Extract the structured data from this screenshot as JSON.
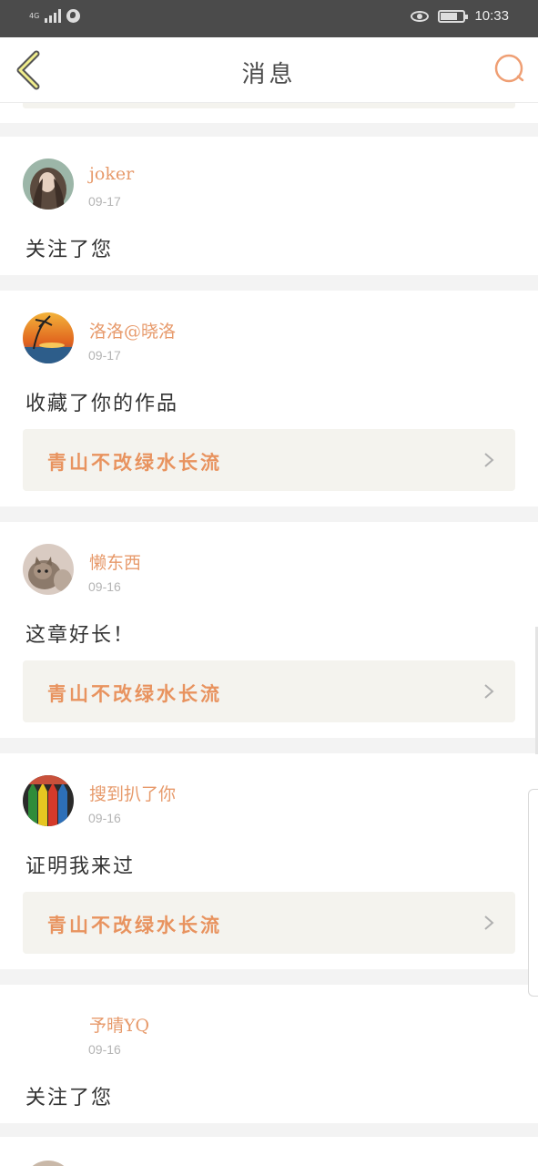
{
  "status_bar": {
    "network": "4G",
    "time": "10:33",
    "icons": [
      "signal-icon",
      "globe-icon",
      "eye-comfort-icon",
      "battery-icon"
    ]
  },
  "header": {
    "title": "消息",
    "back_icon": "chevron-left-icon",
    "search_icon": "search-icon",
    "accent_color": "#e8935f"
  },
  "notifications": [
    {
      "user": "joker",
      "date": "09-17",
      "action": "关注了您",
      "work": null,
      "avatar": "woman-portrait"
    },
    {
      "user": "洛洛@晓洛",
      "date": "09-17",
      "action": "收藏了你的作品",
      "work": "青山不改绿水长流",
      "avatar": "sunset-palm"
    },
    {
      "user": "懒东西",
      "date": "09-16",
      "action": "这章好长！",
      "work": "青山不改绿水长流",
      "avatar": "cat"
    },
    {
      "user": "搜到扒了你",
      "date": "09-16",
      "action": "证明我来过",
      "work": "青山不改绿水长流",
      "avatar": "colored-pencils"
    },
    {
      "user": "予晴YQ",
      "date": "09-16",
      "action": "关注了您",
      "work": null,
      "avatar": "none"
    }
  ]
}
